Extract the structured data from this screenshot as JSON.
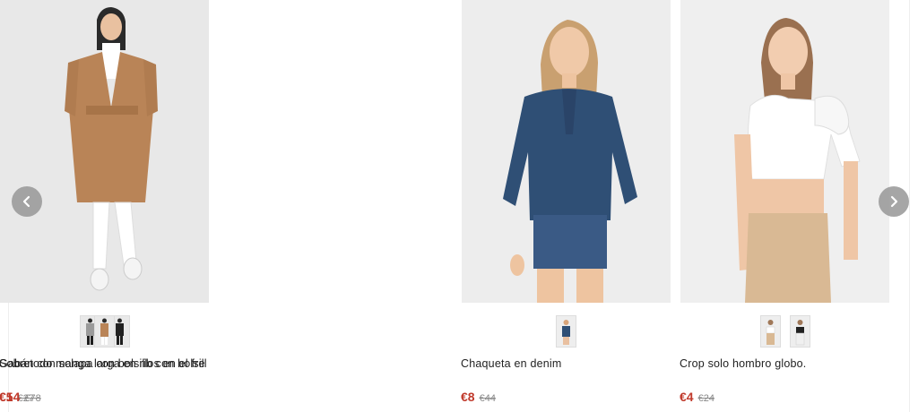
{
  "products": [
    {
      "name": "Chaqueta en denim",
      "price": "€8",
      "old_price": "€44",
      "thumbnails": [
        "denim-jacket-front"
      ]
    },
    {
      "name": "Crop solo hombro globo.",
      "price": "€4",
      "old_price": "€24",
      "thumbnails": [
        "crop-top-white",
        "crop-top-black"
      ]
    },
    {
      "name": "Sobretodo manga larga en rib con bolsill",
      "price": "€5",
      "old_price": "€27",
      "thumbnails": [
        "coat-grey",
        "coat-black"
      ]
    },
    {
      "name": "Gabán con solapa con bolsillos en el fre",
      "price": "€14",
      "old_price": "€78",
      "thumbnails": [
        "trench-camel"
      ]
    }
  ],
  "navigation": {
    "prev_icon": "chevron-left-icon",
    "next_icon": "chevron-right-icon"
  },
  "colors": {
    "price": "#c0392b",
    "old_price": "#888888",
    "arrow_bg": "#969696",
    "photo_bg": "#ececec"
  }
}
